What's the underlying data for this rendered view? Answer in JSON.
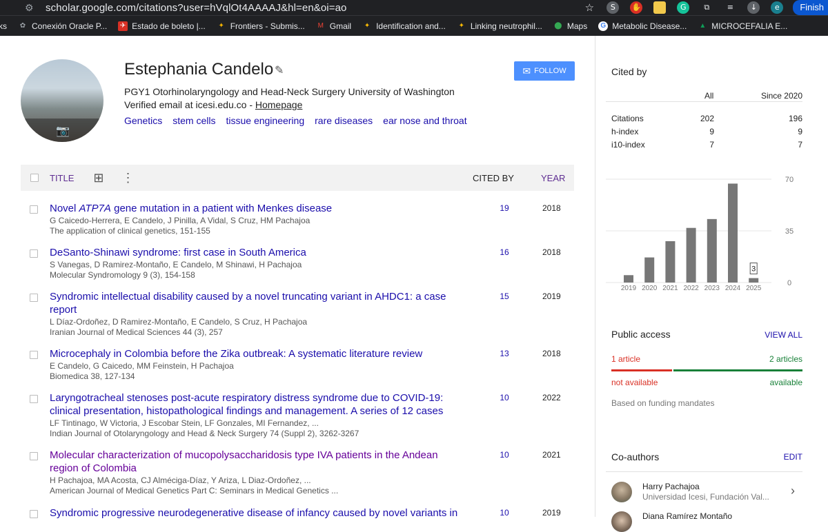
{
  "browser": {
    "url": "scholar.google.com/citations?user=hVqlOt4AAAAJ&hl=en&oi=ao",
    "finish_label": "Finish",
    "profile_initial": "e"
  },
  "bookmarks": [
    {
      "label": "ks",
      "icon": ""
    },
    {
      "label": "Conexión Oracle P...",
      "icon": "oracle-icon"
    },
    {
      "label": "Estado de boleto |...",
      "icon": "avianca-icon"
    },
    {
      "label": "Frontiers - Submis...",
      "icon": "frontiers-icon"
    },
    {
      "label": "Gmail",
      "icon": "gmail-icon"
    },
    {
      "label": "Identification and...",
      "icon": "bookmark-icon"
    },
    {
      "label": "Linking neutrophil...",
      "icon": "bookmark-icon"
    },
    {
      "label": "Maps",
      "icon": "maps-icon"
    },
    {
      "label": "Metabolic Disease...",
      "icon": "google-icon"
    },
    {
      "label": "MICROCEFALIA E...",
      "icon": "drive-icon"
    }
  ],
  "profile": {
    "name": "Estephania Candelo",
    "affiliation": "PGY1 Otorhinolaryngology and Head-Neck Surgery University of Washington",
    "email_prefix": "Verified email at icesi.edu.co - ",
    "homepage_label": "Homepage",
    "interests": [
      "Genetics",
      "stem cells",
      "tissue engineering",
      "rare diseases",
      "ear nose and throat"
    ],
    "follow_label": "FOLLOW"
  },
  "table": {
    "col_title": "TITLE",
    "col_cited": "CITED BY",
    "col_year": "YEAR",
    "rows": [
      {
        "title_pre": "Novel ",
        "title_em": "ATP7A",
        "title_post": " gene mutation in a patient with Menkes disease",
        "authors": "G Caicedo-Herrera, E Candelo, J Pinilla, A Vidal, S Cruz, HM Pachajoa",
        "venue": "The application of clinical genetics, 151-155",
        "cited": "19",
        "year": "2018"
      },
      {
        "title_pre": "DeSanto-Shinawi syndrome: first case in South America",
        "title_em": "",
        "title_post": "",
        "authors": "S Vanegas, D Ramirez-Montaño, E Candelo, M Shinawi, H Pachajoa",
        "venue": "Molecular Syndromology 9 (3), 154-158",
        "cited": "16",
        "year": "2018"
      },
      {
        "title_pre": "Syndromic intellectual disability caused by a novel truncating variant in AHDC1: a case report",
        "title_em": "",
        "title_post": "",
        "authors": "L Díaz-Ordoñez, D Ramirez-Montaño, E Candelo, S Cruz, H Pachajoa",
        "venue": "Iranian Journal of Medical Sciences 44 (3), 257",
        "cited": "15",
        "year": "2019"
      },
      {
        "title_pre": "Microcephaly in Colombia before the Zika outbreak: A systematic literature review",
        "title_em": "",
        "title_post": "",
        "authors": "E Candelo, G Caicedo, MM Feinstein, H Pachajoa",
        "venue": "Biomedica 38, 127-134",
        "cited": "13",
        "year": "2018"
      },
      {
        "title_pre": "Laryngotracheal stenoses post-acute respiratory distress syndrome due to COVID-19: clinical presentation, histopathological findings and management. A series of 12 cases",
        "title_em": "",
        "title_post": "",
        "authors": "LF Tintinago, W Victoria, J Escobar Stein, LF Gonzales, MI Fernandez, ...",
        "venue": "Indian Journal of Otolaryngology and Head & Neck Surgery 74 (Suppl 2), 3262-3267",
        "cited": "10",
        "year": "2022"
      },
      {
        "title_pre": "Molecular characterization of mucopolysaccharidosis type IVA patients in the Andean region of Colombia",
        "title_em": "",
        "title_post": "",
        "authors": "H Pachajoa, MA Acosta, CJ Alméciga-Díaz, Y Ariza, L Diaz-Ordoñez, ...",
        "venue": "American Journal of Medical Genetics Part C: Seminars in Medical Genetics ...",
        "cited": "10",
        "year": "2021"
      },
      {
        "title_pre": "Syndromic progressive neurodegenerative disease of infancy caused by novel variants in",
        "title_em": "",
        "title_post": "",
        "authors": "",
        "venue": "",
        "cited": "10",
        "year": "2019"
      }
    ]
  },
  "cited_by": {
    "title": "Cited by",
    "col_all": "All",
    "col_since": "Since 2020",
    "stats": [
      {
        "label": "Citations",
        "all": "202",
        "since": "196"
      },
      {
        "label": "h-index",
        "all": "9",
        "since": "9"
      },
      {
        "label": "i10-index",
        "all": "7",
        "since": "7"
      }
    ]
  },
  "chart_data": {
    "type": "bar",
    "categories": [
      "2019",
      "2020",
      "2021",
      "2022",
      "2023",
      "2024",
      "2025"
    ],
    "values": [
      5,
      17,
      28,
      37,
      43,
      67,
      3
    ],
    "ylim": [
      0,
      70
    ],
    "yticks": [
      "0",
      "35",
      "70"
    ],
    "annotations": [
      {
        "category": "2025",
        "text": "3"
      }
    ],
    "grid": true
  },
  "public_access": {
    "title": "Public access",
    "view_all": "VIEW ALL",
    "left_count": "1 article",
    "right_count": "2 articles",
    "left_label": "not available",
    "right_label": "available",
    "note": "Based on funding mandates"
  },
  "coauthors": {
    "title": "Co-authors",
    "edit": "EDIT",
    "list": [
      {
        "name": "Harry Pachajoa",
        "affiliation": "Universidad Icesi, Fundación Val..."
      },
      {
        "name": "Diana Ramírez Montaño",
        "affiliation": ""
      }
    ]
  },
  "colors": {
    "link": "#1a0dab",
    "visited": "#660099",
    "accent": "#4d90fe",
    "bar": "#777777",
    "not_available": "#d93025",
    "available": "#188038"
  }
}
